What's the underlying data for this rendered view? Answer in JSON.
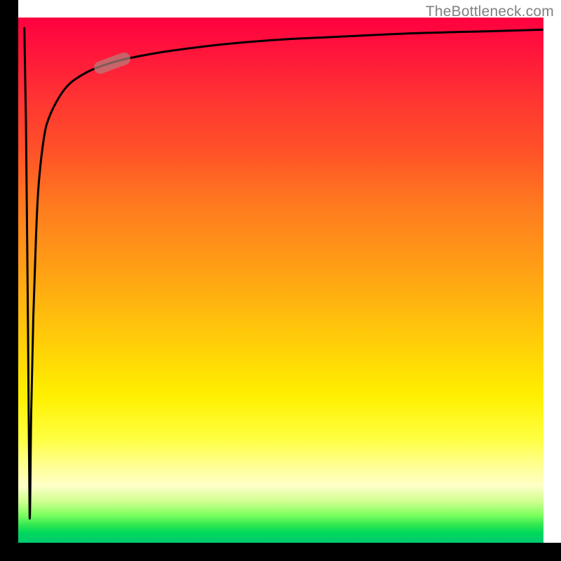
{
  "attribution": "TheBottleneck.com",
  "chart_data": {
    "type": "line",
    "title": "",
    "xlabel": "",
    "ylabel": "",
    "xlim": [
      0,
      100
    ],
    "ylim": [
      0,
      100
    ],
    "series": [
      {
        "name": "curve",
        "x": [
          2.3,
          2.6,
          3,
          3.5,
          4,
          5,
          6,
          8,
          10,
          13,
          16,
          20,
          25,
          30,
          40,
          50,
          60,
          75,
          90,
          100
        ],
        "y": [
          5,
          25,
          43,
          58,
          68,
          77,
          81,
          85,
          87.5,
          89.5,
          90.8,
          92,
          93,
          93.8,
          95,
          95.8,
          96.3,
          97,
          97.4,
          97.7
        ]
      }
    ],
    "marker": {
      "x": 18,
      "y": 91.4
    },
    "gradient_colors": {
      "top": "#ff0040",
      "mid_top": "#ff8020",
      "mid": "#ffff00",
      "mid_bottom": "#ffff80",
      "bottom": "#00d060"
    }
  }
}
